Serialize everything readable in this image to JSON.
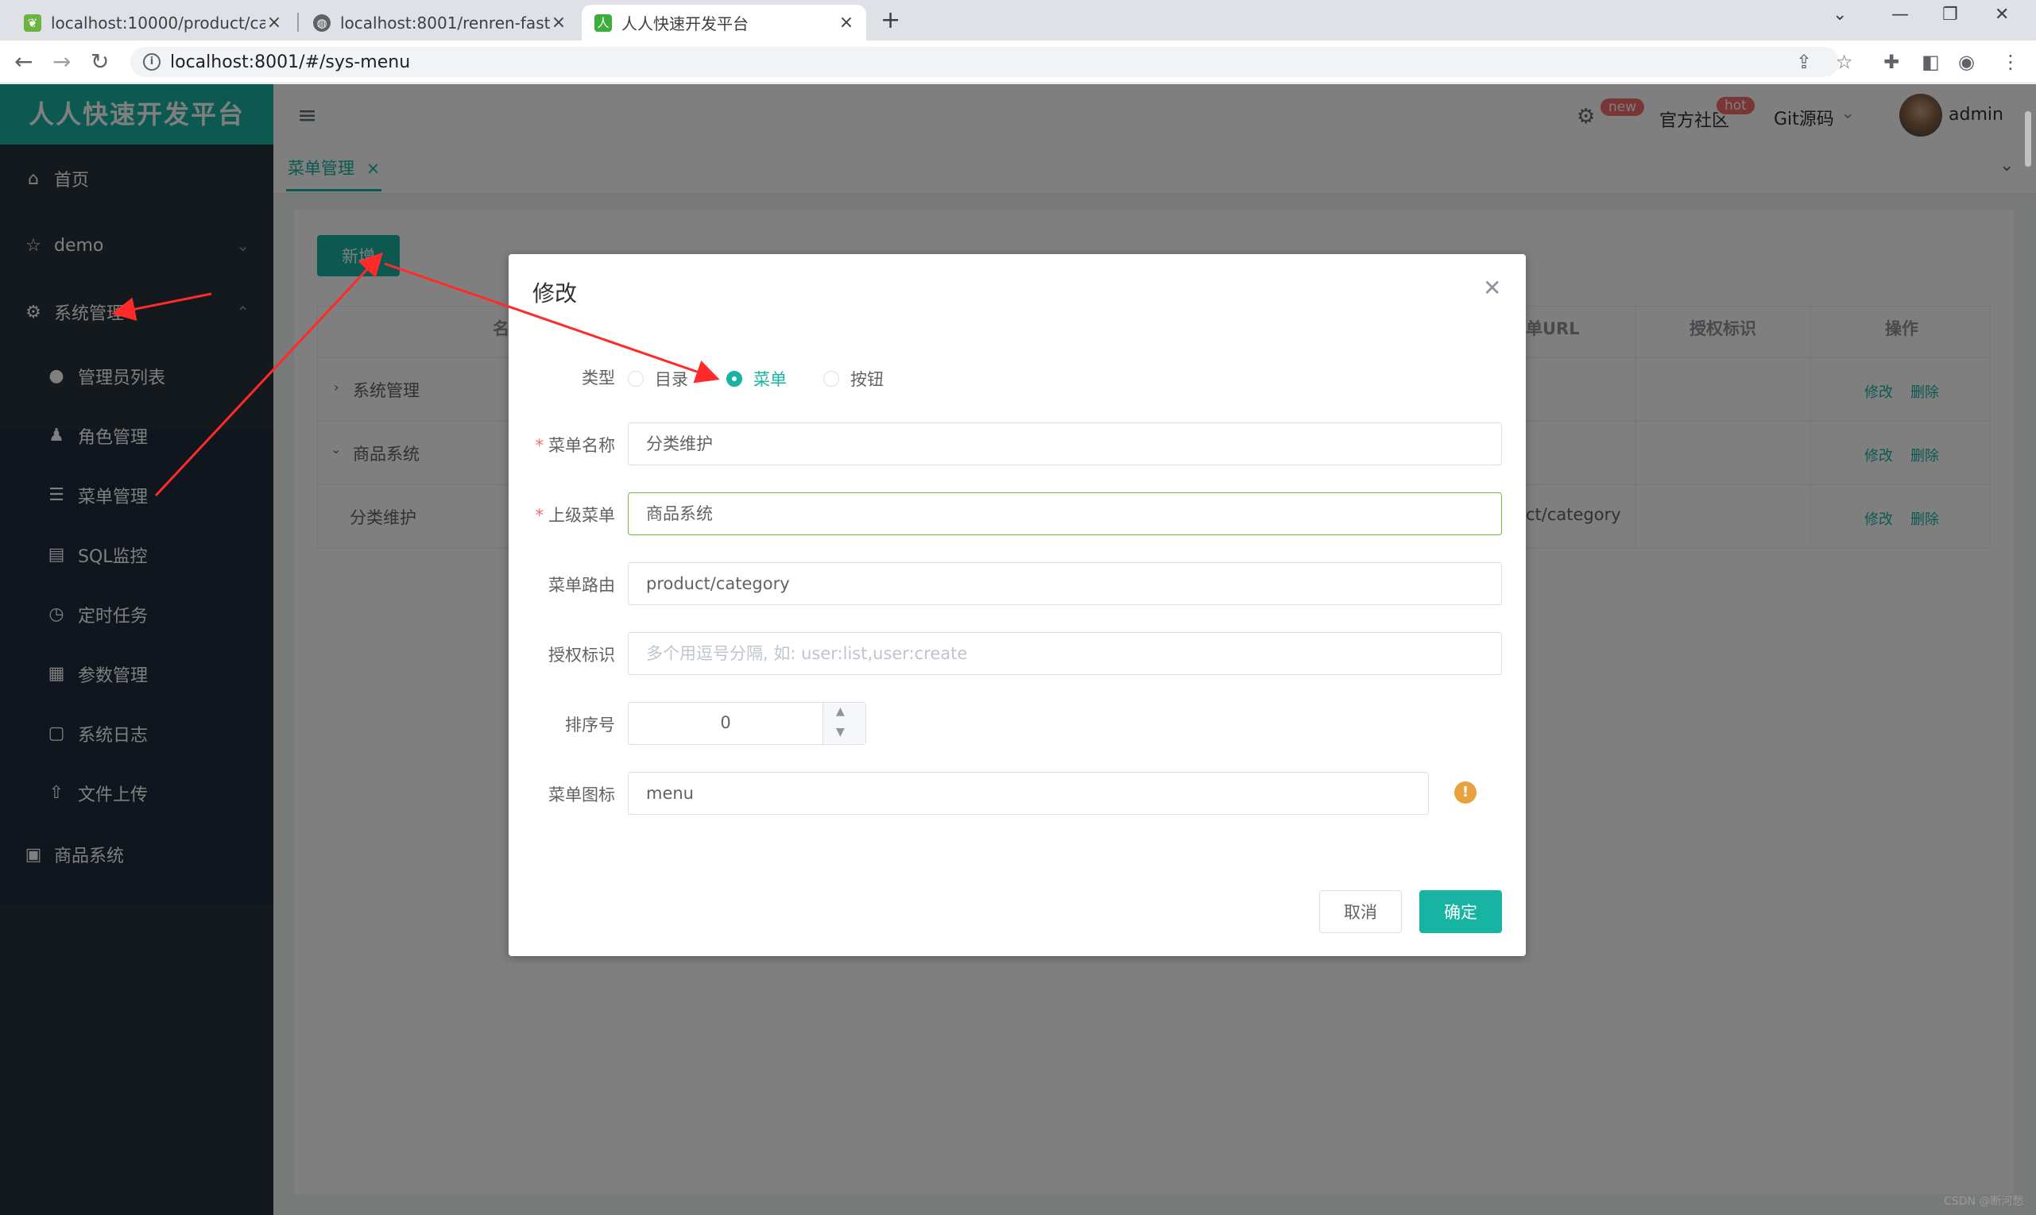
{
  "browser": {
    "tabs": [
      {
        "title": "localhost:10000/product/categ",
        "favicon": "spring-leaf-icon"
      },
      {
        "title": "localhost:8001/renren-fast/",
        "favicon": "globe-icon"
      },
      {
        "title": "人人快速开发平台",
        "favicon": "renren-logo-icon"
      }
    ],
    "url": "localhost:8001/#/sys-menu"
  },
  "app": {
    "brand": "人人快速开发平台",
    "sidebar": {
      "items": [
        {
          "label": "首页",
          "icon": "home-icon"
        },
        {
          "label": "demo",
          "icon": "star-icon"
        },
        {
          "label": "系统管理",
          "icon": "gear-icon"
        },
        {
          "label": "商品系统",
          "icon": "image-icon"
        }
      ],
      "sub_items": [
        {
          "label": "管理员列表",
          "icon": "user-icon"
        },
        {
          "label": "角色管理",
          "icon": "role-icon"
        },
        {
          "label": "菜单管理",
          "icon": "list-icon"
        },
        {
          "label": "SQL监控",
          "icon": "monitor-icon"
        },
        {
          "label": "定时任务",
          "icon": "clock-icon"
        },
        {
          "label": "参数管理",
          "icon": "param-icon"
        },
        {
          "label": "系统日志",
          "icon": "log-icon"
        },
        {
          "label": "文件上传",
          "icon": "upload-icon"
        }
      ]
    },
    "topbar": {
      "new_badge": "new",
      "community": "官方社区",
      "hot_badge": "hot",
      "git": "Git源码",
      "user": "admin"
    },
    "page_tab": "菜单管理",
    "add_button": "新增",
    "table": {
      "headers": {
        "name": "名",
        "url": "单URL",
        "perms": "授权标识",
        "ops": "操作"
      },
      "rows": [
        {
          "name": "系统管理",
          "url": "",
          "edit": "修改",
          "delete": "删除"
        },
        {
          "name": "商品系统",
          "url": "",
          "edit": "修改",
          "delete": "删除"
        },
        {
          "name": "分类维护",
          "url": "ct/category",
          "edit": "修改",
          "delete": "删除"
        }
      ]
    }
  },
  "dialog": {
    "title": "修改",
    "type_label": "类型",
    "type_options": [
      "目录",
      "菜单",
      "按钮"
    ],
    "type_selected": "菜单",
    "name_label": "菜单名称",
    "name_value": "分类维护",
    "parent_label": "上级菜单",
    "parent_value": "商品系统",
    "route_label": "菜单路由",
    "route_value": "product/category",
    "perms_label": "授权标识",
    "perms_placeholder": "多个用逗号分隔, 如: user:list,user:create",
    "order_label": "排序号",
    "order_value": "0",
    "icon_label": "菜单图标",
    "icon_value": "menu",
    "cancel": "取消",
    "confirm": "确定"
  },
  "watermark": "CSDN @断河愁",
  "colors": {
    "accent": "#17b3a3",
    "sidebar": "#263238",
    "danger": "#f56c6c",
    "warning": "#e6a23c"
  }
}
